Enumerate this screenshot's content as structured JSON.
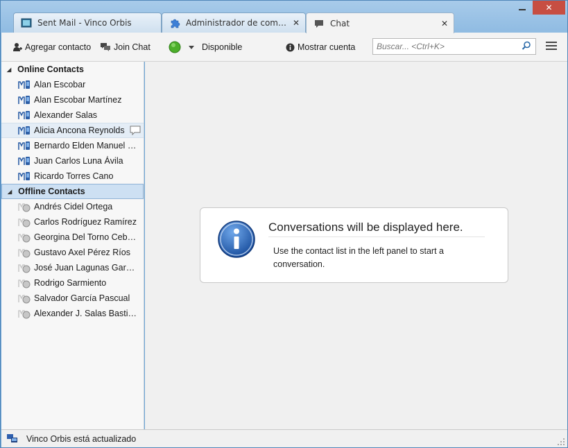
{
  "tabs": [
    {
      "label": "Sent Mail - Vinco Orbis",
      "icon": "mail-window-icon"
    },
    {
      "label": "Administrador de complementos",
      "icon": "puzzle-piece-icon"
    },
    {
      "label": "Chat",
      "icon": "chat-bubble-icon"
    }
  ],
  "toolbar": {
    "add_contact": "Agregar contacto",
    "join_chat": "Join Chat",
    "status": "Disponible",
    "show_account": "Mostrar cuenta",
    "search_placeholder": "Buscar... <Ctrl+K>",
    "status_color": "#4caf2a"
  },
  "sidebar": {
    "online_header": "Online Contacts",
    "online": [
      "Alan Escobar",
      "Alan Escobar Martínez",
      "Alexander Salas",
      "Alicia Ancona Reynolds",
      "Bernardo Elden Manuel Barrera",
      "Juan Carlos Luna Ávila",
      "Ricardo Torres Cano"
    ],
    "offline_header": "Offline Contacts",
    "offline": [
      "Andrés Cidel Ortega",
      "Carlos Rodríguez Ramírez",
      "Georgina Del Torno Ceballos",
      "Gustavo Axel Pérez Ríos",
      "José Juan Lagunas García",
      "Rodrigo Sarmiento",
      "Salvador García Pascual",
      "Alexander J. Salas Bastidas"
    ]
  },
  "main": {
    "title": "Conversations will be displayed here.",
    "body": "Use the contact list in the left panel to start a conversation."
  },
  "statusbar": {
    "text": "Vinco Orbis está actualizado"
  },
  "colors": {
    "frame": "#6fa6d6",
    "selection": "#cde0f3",
    "close_button": "#c74e42"
  }
}
